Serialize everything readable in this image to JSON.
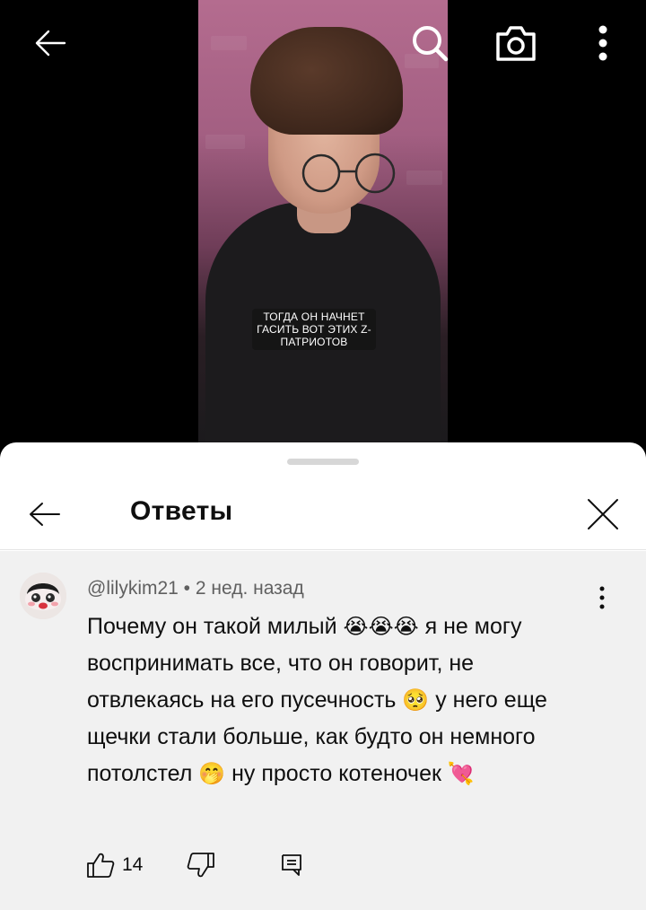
{
  "top_bar": {
    "icons": [
      "back-arrow-icon",
      "search-icon",
      "camera-icon",
      "more-vertical-icon"
    ]
  },
  "video": {
    "caption": "ТОГДА ОН НАЧНЕТ ГАСИТЬ ВОТ ЭТИХ Z-ПАТРИОТОВ"
  },
  "replies_panel": {
    "title": "Ответы"
  },
  "comment": {
    "author": "@lilykim21",
    "separator": " • ",
    "time": "2 нед. назад",
    "text_parts": [
      "Почему он такой милый ",
      "😭😭😭",
      " я не могу воспринимать все, что он говорит, не отвлекаясь на его пусечность ",
      "🥺",
      " у него еще щечки стали больше, как будто он немного потолстел ",
      "🤭",
      " ну просто котеночек ",
      "💘"
    ],
    "likes": "14"
  },
  "colors": {
    "sheet_bg": "#ffffff",
    "comment_bg": "#f1f1f1",
    "meta_text": "#606060",
    "primary_text": "#0f0f0f"
  }
}
